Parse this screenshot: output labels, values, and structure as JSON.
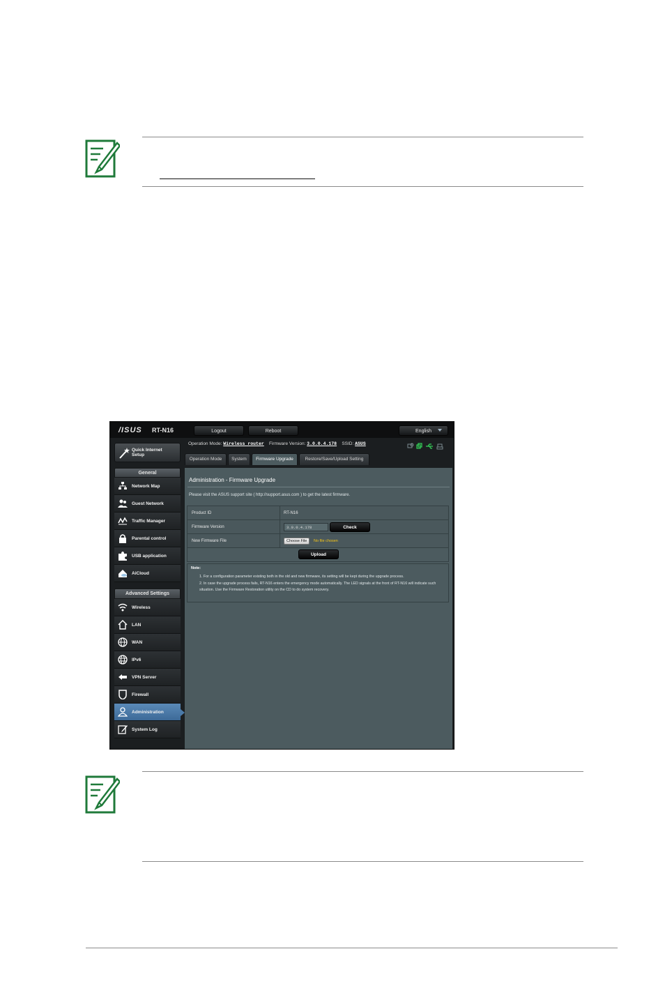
{
  "router": {
    "brand": "/ISUS",
    "model": "RT-N16",
    "top_buttons": {
      "logout": "Logout",
      "reboot": "Reboot",
      "language": "English"
    },
    "status": {
      "op_mode_label": "Operation Mode:",
      "op_mode_value": "Wireless router",
      "fw_label": "Firmware Version:",
      "fw_value": "3.0.0.4.178",
      "ssid_label": "SSID:",
      "ssid_value": "ASUS"
    },
    "sidebar": {
      "quick_setup": "Quick Internet Setup",
      "general_header": "General",
      "general_items": [
        "Network Map",
        "Guest Network",
        "Traffic Manager",
        "Parental control",
        "USB application",
        "AiCloud"
      ],
      "advanced_header": "Advanced Settings",
      "advanced_items": [
        "Wireless",
        "LAN",
        "WAN",
        "IPv6",
        "VPN Server",
        "Firewall",
        "Administration",
        "System Log"
      ],
      "active_item": "Administration"
    },
    "tabs": [
      "Operation Mode",
      "System",
      "Firmware Upgrade",
      "Restore/Save/Upload Setting"
    ],
    "active_tab": "Firmware Upgrade",
    "page": {
      "title": "Administration - Firmware Upgrade",
      "intro": "Please visit the ASUS support site ( http://support.asus.com ) to get the latest firmware.",
      "rows": {
        "product_id_label": "Product ID",
        "product_id_value": "RT-N16",
        "fw_version_label": "Firmware Version",
        "fw_version_value": "3.0.0.4.178",
        "check_button": "Check",
        "new_fw_label": "New Firmware File",
        "choose_file": "Choose File",
        "no_file": "No file chosen"
      },
      "upload_button": "Upload",
      "note_title": "Note:",
      "notes": [
        "1.  For a configuration parameter existing both in the old and new firmware, its setting will be kept during the upgrade process.",
        "2.  In case the upgrade process fails, RT-N16 enters the emergency mode automatically. The LED signals at the front of RT-N16 will indicate such situation. Use the Firmware Restoration utility on the CD to do system recovery."
      ]
    }
  },
  "colors": {
    "note_icon": "#1f7a3a",
    "content_bg": "#4c5b5f",
    "active_blue": "#4a7aa8",
    "no_file_yellow": "#f5c518"
  }
}
